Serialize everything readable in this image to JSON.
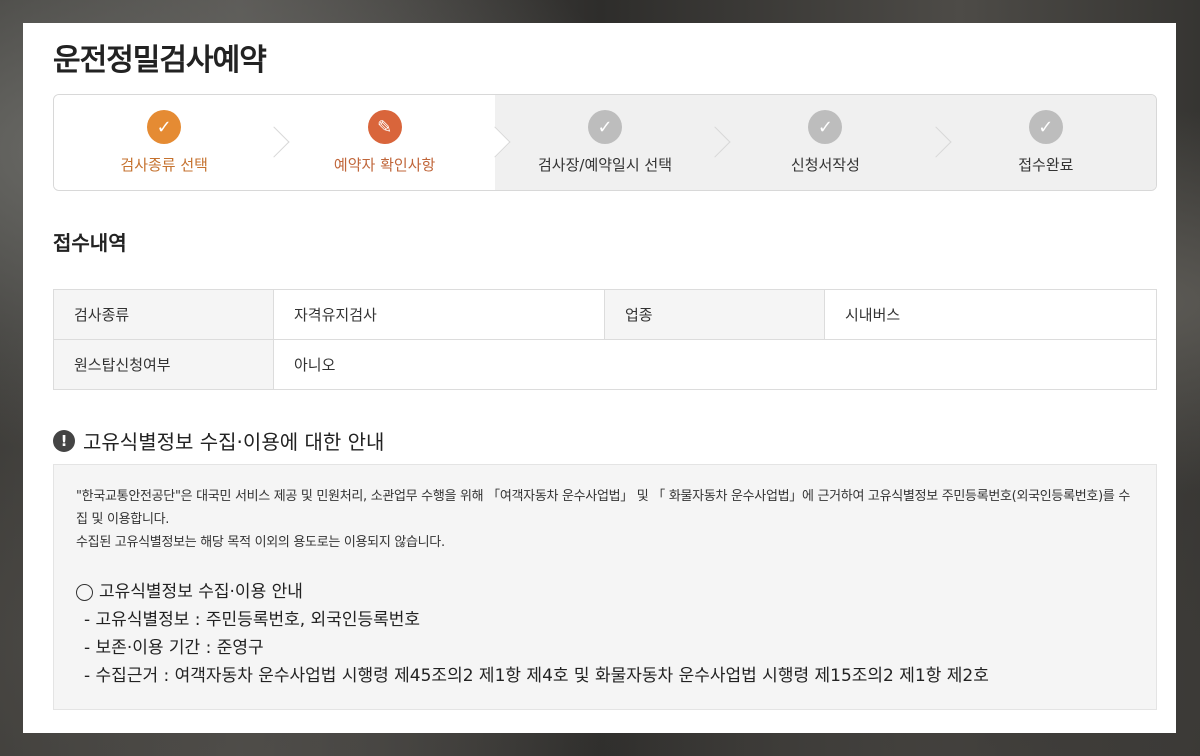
{
  "page": {
    "title": "운전정밀검사예약"
  },
  "steps": [
    {
      "label": "검사종류 선택",
      "state": "done",
      "icon": "check-icon"
    },
    {
      "label": "예약자 확인사항",
      "state": "current",
      "icon": "pencil-icon"
    },
    {
      "label": "검사장/예약일시 선택",
      "state": "pending",
      "icon": "check-icon"
    },
    {
      "label": "신청서작성",
      "state": "pending",
      "icon": "check-icon"
    },
    {
      "label": "접수완료",
      "state": "pending",
      "icon": "check-icon"
    }
  ],
  "receipt": {
    "heading": "접수내역",
    "rows": [
      {
        "label1": "검사종류",
        "value1": "자격유지검사",
        "label2": "업종",
        "value2": "시내버스"
      },
      {
        "label1": "원스탑신청여부",
        "value1": "아니오"
      }
    ]
  },
  "notice": {
    "heading": "고유식별정보 수집·이용에 대한 안내",
    "paragraph1": "\"한국교통안전공단\"은 대국민 서비스 제공 및 민원처리, 소관업무 수행을 위해 「여객자동차 운수사업법」 및 「 화물자동차 운수사업법」에 근거하여 고유식별정보 주민등록번호(외국인등록번호)를 수집 및 이용합니다.",
    "paragraph2": "수집된 고유식별정보는 해당 목적 이외의 용도로는 이용되지 않습니다.",
    "guide_title": "고유식별정보 수집·이용 안내",
    "guide_items": [
      "- 고유식별정보 : 주민등록번호, 외국인등록번호",
      "- 보존·이용 기간 : 준영구",
      "- 수집근거 : 여객자동차 운수사업법 시행령 제45조의2 제1항 제4호 및 화물자동차 운수사업법 시행령 제15조의2 제1항 제2호"
    ]
  },
  "colors": {
    "step_done": "#e58b33",
    "step_current": "#d9653b",
    "step_pending": "#bdbdbd"
  }
}
